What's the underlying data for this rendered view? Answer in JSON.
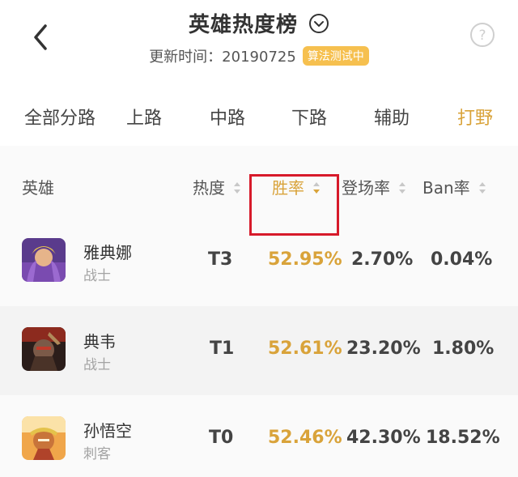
{
  "header": {
    "title": "英雄热度榜",
    "update_label": "更新时间：20190725",
    "badge": "算法测试中"
  },
  "tabs": [
    {
      "label": "全部分路",
      "active": false
    },
    {
      "label": "上路",
      "active": false
    },
    {
      "label": "中路",
      "active": false
    },
    {
      "label": "下路",
      "active": false
    },
    {
      "label": "辅助",
      "active": false
    },
    {
      "label": "打野",
      "active": true
    }
  ],
  "columns": {
    "hero": "英雄",
    "heat": "热度",
    "winrate": "胜率",
    "pickrate": "登场率",
    "banrate": "Ban率"
  },
  "rows": [
    {
      "name": "雅典娜",
      "role": "战士",
      "tier": "T3",
      "winrate": "52.95%",
      "pickrate": "2.70%",
      "banrate": "0.04%"
    },
    {
      "name": "典韦",
      "role": "战士",
      "tier": "T1",
      "winrate": "52.61%",
      "pickrate": "23.20%",
      "banrate": "1.80%"
    },
    {
      "name": "孙悟空",
      "role": "刺客",
      "tier": "T0",
      "winrate": "52.46%",
      "pickrate": "42.30%",
      "banrate": "18.52%"
    }
  ],
  "colors": {
    "accent": "#d9a33a",
    "badge": "#f6c04f",
    "highlight_box": "#d71a2a"
  }
}
